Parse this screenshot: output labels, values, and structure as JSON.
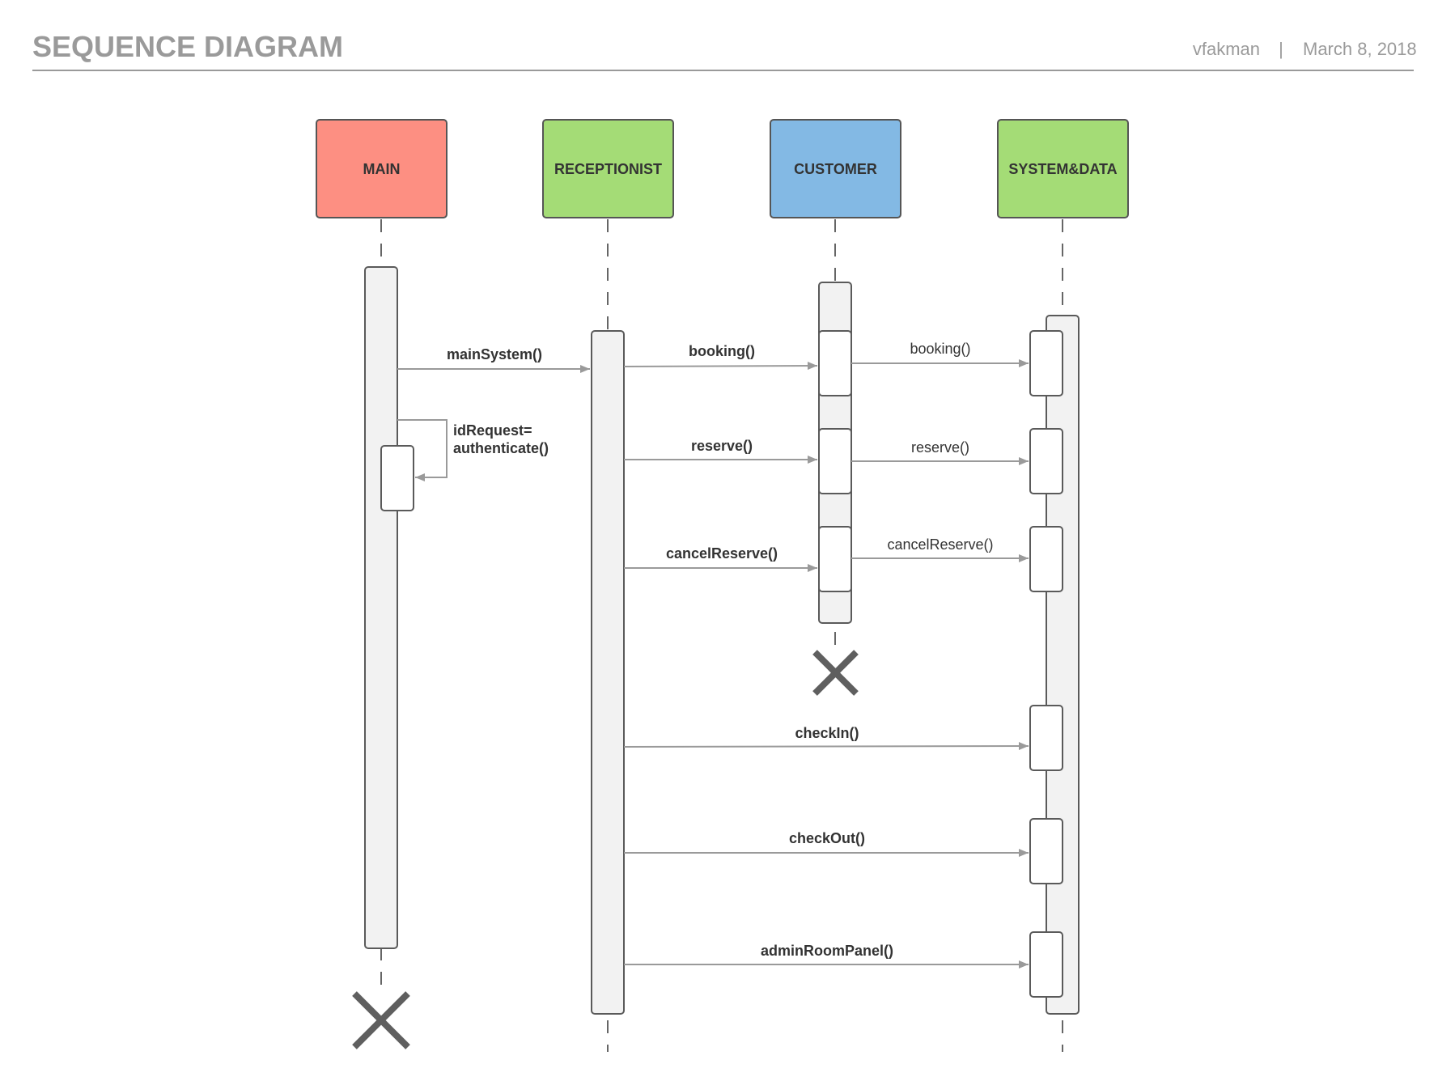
{
  "header": {
    "title": "SEQUENCE DIAGRAM",
    "author": "vfakman",
    "separator": "|",
    "date": "March 8, 2018"
  },
  "actors": [
    {
      "label": "MAIN",
      "color": "#fd8f82"
    },
    {
      "label": "RECEPTIONIST",
      "color": "#a4dc76"
    },
    {
      "label": "CUSTOMER",
      "color": "#83b9e4"
    },
    {
      "label": "SYSTEM&DATA",
      "color": "#a4dc76"
    }
  ],
  "messages": {
    "main_system": "mainSystem()",
    "id_request_line1": "idRequest=",
    "id_request_line2": "authenticate()",
    "booking_receptionist": "booking()",
    "booking_customer": "booking()",
    "reserve_receptionist": "reserve()",
    "reserve_customer": "reserve()",
    "cancel_receptionist": "cancelReserve()",
    "cancel_customer": "cancelReserve()",
    "check_in": "checkIn()",
    "check_out": "checkOut()",
    "admin_room_panel": "adminRoomPanel()"
  },
  "colors": {
    "lifeline": "#666666",
    "arrow": "#9a9a9a",
    "activation_fill": "#f2f2f2",
    "destroy_mark": "#5f5f5f"
  }
}
